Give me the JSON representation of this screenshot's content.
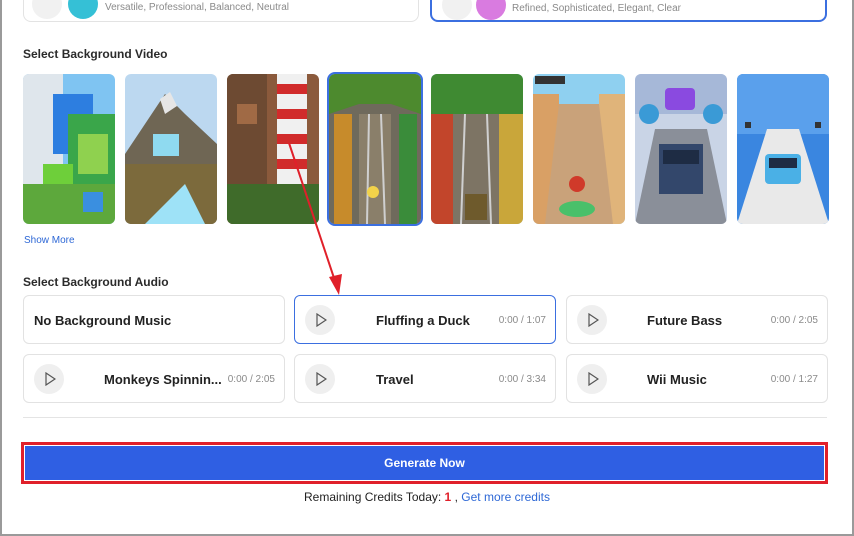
{
  "voices": [
    {
      "desc": "Versatile, Professional, Balanced, Neutral",
      "color": "#35c0d6"
    },
    {
      "desc": "Refined, Sophisticated, Elegant, Clear",
      "color": "#d97be0"
    }
  ],
  "video_section": {
    "title": "Select Background Video",
    "show_more": "Show More",
    "selected_index": 3
  },
  "audio_section": {
    "title": "Select Background Audio",
    "items": [
      {
        "name": "No Background Music",
        "time": ""
      },
      {
        "name": "Fluffing a Duck",
        "time": "0:00 / 1:07"
      },
      {
        "name": "Future Bass",
        "time": "0:00 / 2:05"
      },
      {
        "name": "Monkeys Spinnin...",
        "time": "0:00 / 2:05"
      },
      {
        "name": "Travel",
        "time": "0:00 / 3:34"
      },
      {
        "name": "Wii Music",
        "time": "0:00 / 1:27"
      }
    ],
    "selected_index": 1
  },
  "generate": {
    "label": "Generate Now"
  },
  "credits": {
    "text": "Remaining Credits Today:",
    "count": "1",
    "separator": ",",
    "link": "Get more credits"
  },
  "colors": {
    "accent": "#2f5fe3",
    "highlight": "#e0202a",
    "selected_border": "#3b6fe0",
    "link": "#2e68d6"
  }
}
